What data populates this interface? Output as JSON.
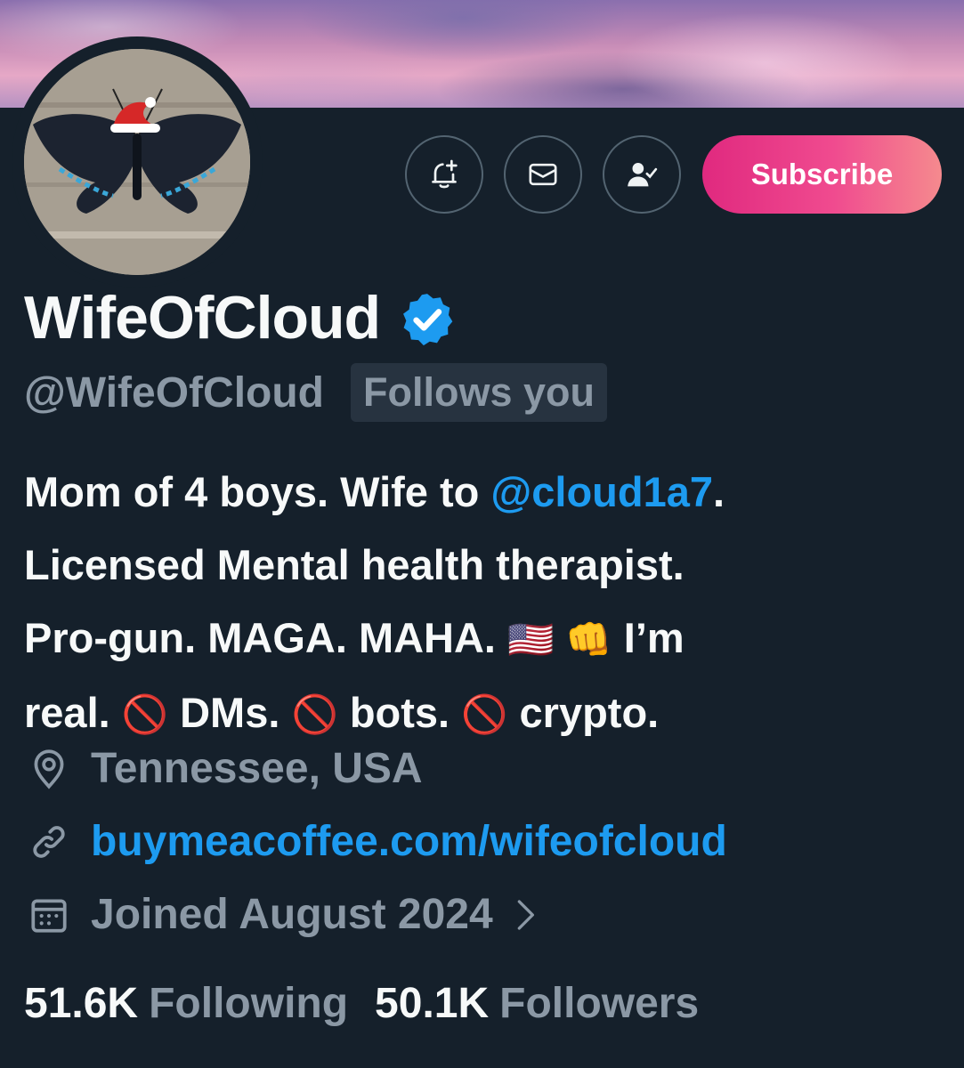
{
  "banner": {
    "description_icon": "cloud-sky-banner"
  },
  "avatar": {
    "icon": "butterfly-santa-hat-avatar"
  },
  "actions": {
    "notify_icon": "bell-plus-icon",
    "message_icon": "envelope-icon",
    "following_icon": "person-check-icon",
    "subscribe_label": "Subscribe"
  },
  "profile": {
    "display_name": "WifeOfCloud",
    "verified_icon": "verified-badge-icon",
    "handle": "@WifeOfCloud",
    "follows_you": "Follows you"
  },
  "bio": {
    "line1_a": "Mom of 4 boys. Wife to ",
    "mention": "@cloud1a7",
    "line1_b": ".",
    "line2": "Licensed Mental health therapist.",
    "line3_a": "Pro-gun. MAGA. MAHA. ",
    "flag": "🇺🇸",
    "fist": "👊",
    "line3_b": " I’m",
    "line4_a": "real. ",
    "no1": "🚫",
    "line4_b": " DMs. ",
    "no2": "🚫",
    "line4_c": " bots. ",
    "no3": "🚫",
    "line4_d": " crypto."
  },
  "meta": {
    "location": "Tennessee, USA",
    "location_icon": "location-pin-icon",
    "url": "buymeacoffee.com/wifeofcloud",
    "url_icon": "link-icon",
    "joined": "Joined August 2024",
    "joined_icon": "calendar-icon"
  },
  "stats": {
    "following_count": "51.6K",
    "following_label": "Following",
    "followers_count": "50.1K",
    "followers_label": "Followers"
  },
  "colors": {
    "background": "#15202b",
    "accent": "#1d9bf0",
    "muted": "#8b98a5",
    "subscribe_start": "#e0297f",
    "subscribe_end": "#f58a8e"
  }
}
